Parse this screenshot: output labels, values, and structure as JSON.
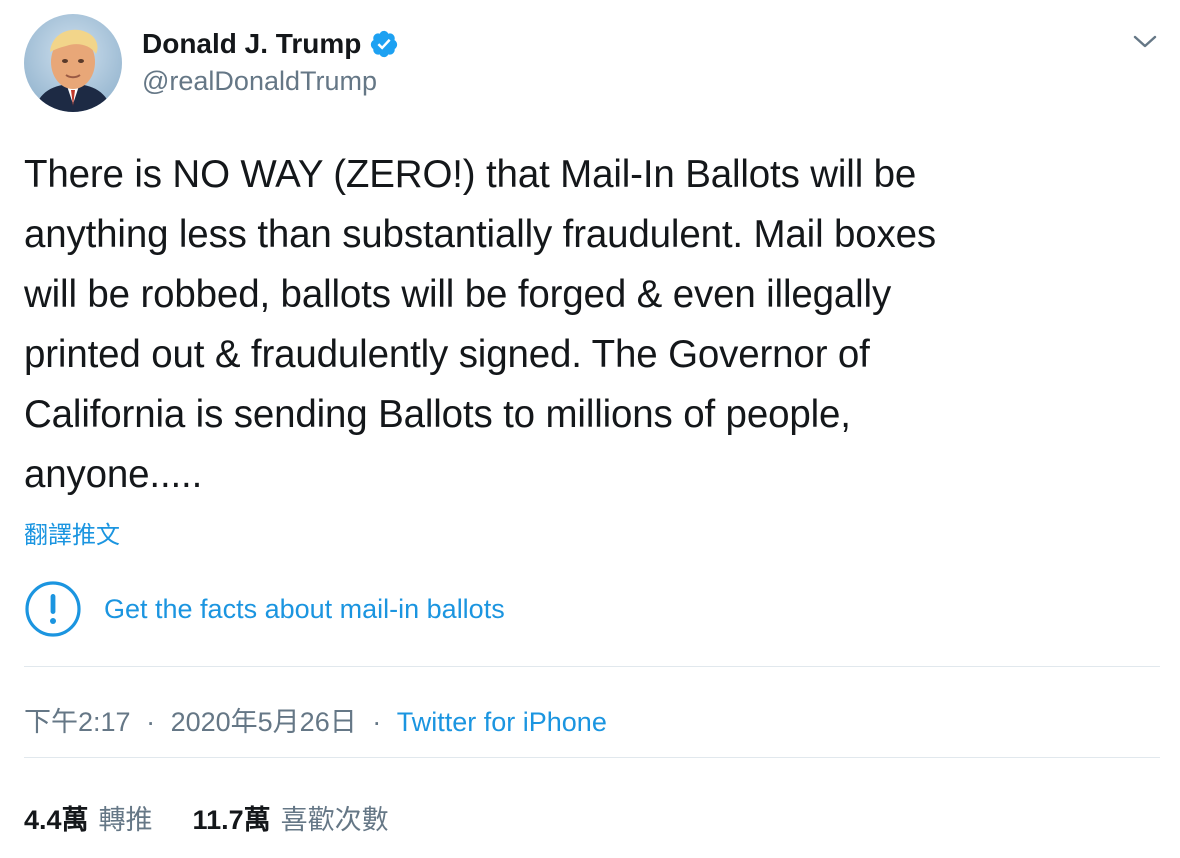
{
  "author": {
    "display_name": "Donald J. Trump",
    "handle": "@realDonaldTrump",
    "verified": true,
    "avatar_icon": "profile-photo",
    "verified_icon": "verified-badge-icon"
  },
  "tweet": {
    "text": "There is NO WAY (ZERO!) that Mail-In Ballots will be\nanything less than substantially fraudulent. Mail boxes\nwill be robbed, ballots will be forged & even illegally\nprinted out & fraudulently signed. The Governor of\nCalifornia is sending Ballots to millions of people,\nanyone.....",
    "translate_label": "翻譯推文"
  },
  "fact_check": {
    "icon": "exclamation-circle-icon",
    "label": "Get the facts about mail-in ballots"
  },
  "meta": {
    "time": "下午2:17",
    "separator": "·",
    "date": "2020年5月26日",
    "source": "Twitter for iPhone"
  },
  "stats": {
    "retweets": {
      "count": "4.4萬",
      "label": "轉推"
    },
    "likes": {
      "count": "11.7萬",
      "label": "喜歡次數"
    }
  },
  "colors": {
    "link": "#1b95e0",
    "secondary_text": "#657786",
    "primary_text": "#14171a",
    "divider": "#e1e8ed"
  }
}
